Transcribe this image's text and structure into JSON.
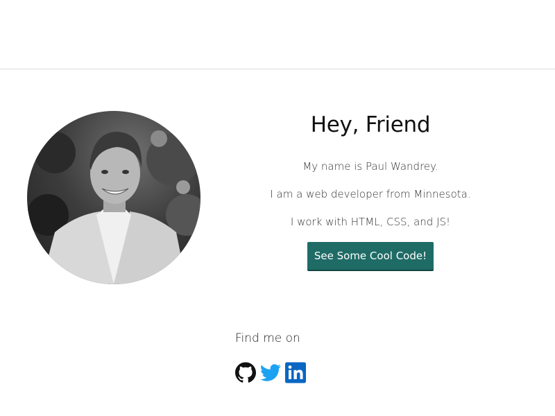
{
  "hero": {
    "heading": "Hey, Friend",
    "line1": "My name is Paul Wandrey.",
    "line2": "I am a web developer from Minnesota.",
    "line3": "I work with HTML, CSS, and JS!",
    "cta_label": "See Some Cool Code!"
  },
  "social": {
    "heading": "Find me on",
    "links": [
      {
        "icon": "github-icon",
        "color": "#111111"
      },
      {
        "icon": "twitter-icon",
        "color": "#1da1f2"
      },
      {
        "icon": "linkedin-icon",
        "color": "#0a66c2"
      }
    ]
  },
  "theme": {
    "accent": "#1f6b66",
    "divider": "#dcdcdc"
  }
}
